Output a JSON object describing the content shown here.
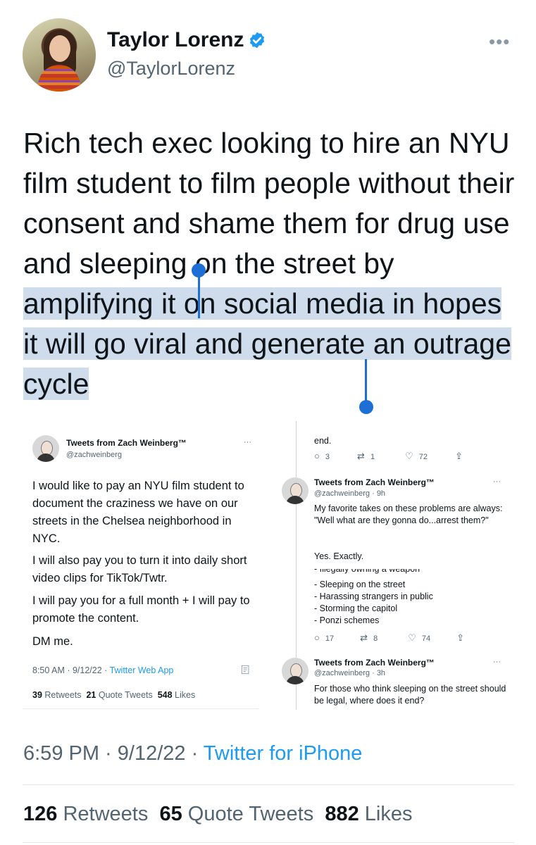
{
  "author": {
    "name": "Taylor Lorenz",
    "handle": "@TaylorLorenz",
    "more_glyph": "•••",
    "verified_icon": "verified-badge-icon"
  },
  "tweet": {
    "text_plain": "Rich tech exec looking to hire an NYU film student to film people without their consent and shame them for drug use and sleeping on the street by ",
    "text_selected": "amplifying it on social media in hopes it will go viral and generate an outrage cycle",
    "selection_color": "#cfdcec",
    "accent": "#1d6fd6"
  },
  "embed": {
    "left": {
      "name": "Tweets from Zach Weinberg™",
      "handle": "@zachweinberg",
      "more": "···",
      "p1": "I would like to pay an NYU film student to document the craziness we have on our streets in the Chelsea neighborhood in NYC.",
      "p2": "I will also pay you to turn it into daily short video clips for TikTok/Twtr.",
      "p3": "I will pay you for a full month + I will pay to promote the content.",
      "p4": "DM me.",
      "meta_time": "8:50 AM · 9/12/22 · ",
      "meta_app": "Twitter Web App",
      "retweets": "39",
      "retweets_label": "Retweets",
      "quotes": "21",
      "quotes_label": "Quote Tweets",
      "likes": "548",
      "likes_label": "Likes"
    },
    "right": {
      "top_text": "end.",
      "actions1": {
        "replies": "3",
        "retweets": "1",
        "likes": "72"
      },
      "t2_name": "Tweets from Zach Weinberg™",
      "t2_handle": "@zachweinberg · 9h",
      "t2_more": "···",
      "t2_text": "My favorite takes on these problems are always: \"Well what are they gonna do...arrest them?\"",
      "t2_text2": "Yes. Exactly.",
      "list_cut": "- Illegally owning a weapon",
      "list": [
        "- Sleeping on the street",
        "- Harassing strangers in public",
        "- Storming the capitol",
        "- Ponzi schemes"
      ],
      "actions2": {
        "replies": "17",
        "retweets": "8",
        "likes": "74"
      },
      "t3_name": "Tweets from Zach Weinberg™",
      "t3_handle": "@zachweinberg · 3h",
      "t3_more": "···",
      "t3_text": "For those who think sleeping on the street should be legal, where does it end?"
    }
  },
  "footer": {
    "time": "6:59 PM · 9/12/22 · ",
    "app": "Twitter for iPhone",
    "retweets": "126",
    "retweets_label": "Retweets",
    "quotes": "65",
    "quotes_label": "Quote Tweets",
    "likes": "882",
    "likes_label": "Likes"
  }
}
